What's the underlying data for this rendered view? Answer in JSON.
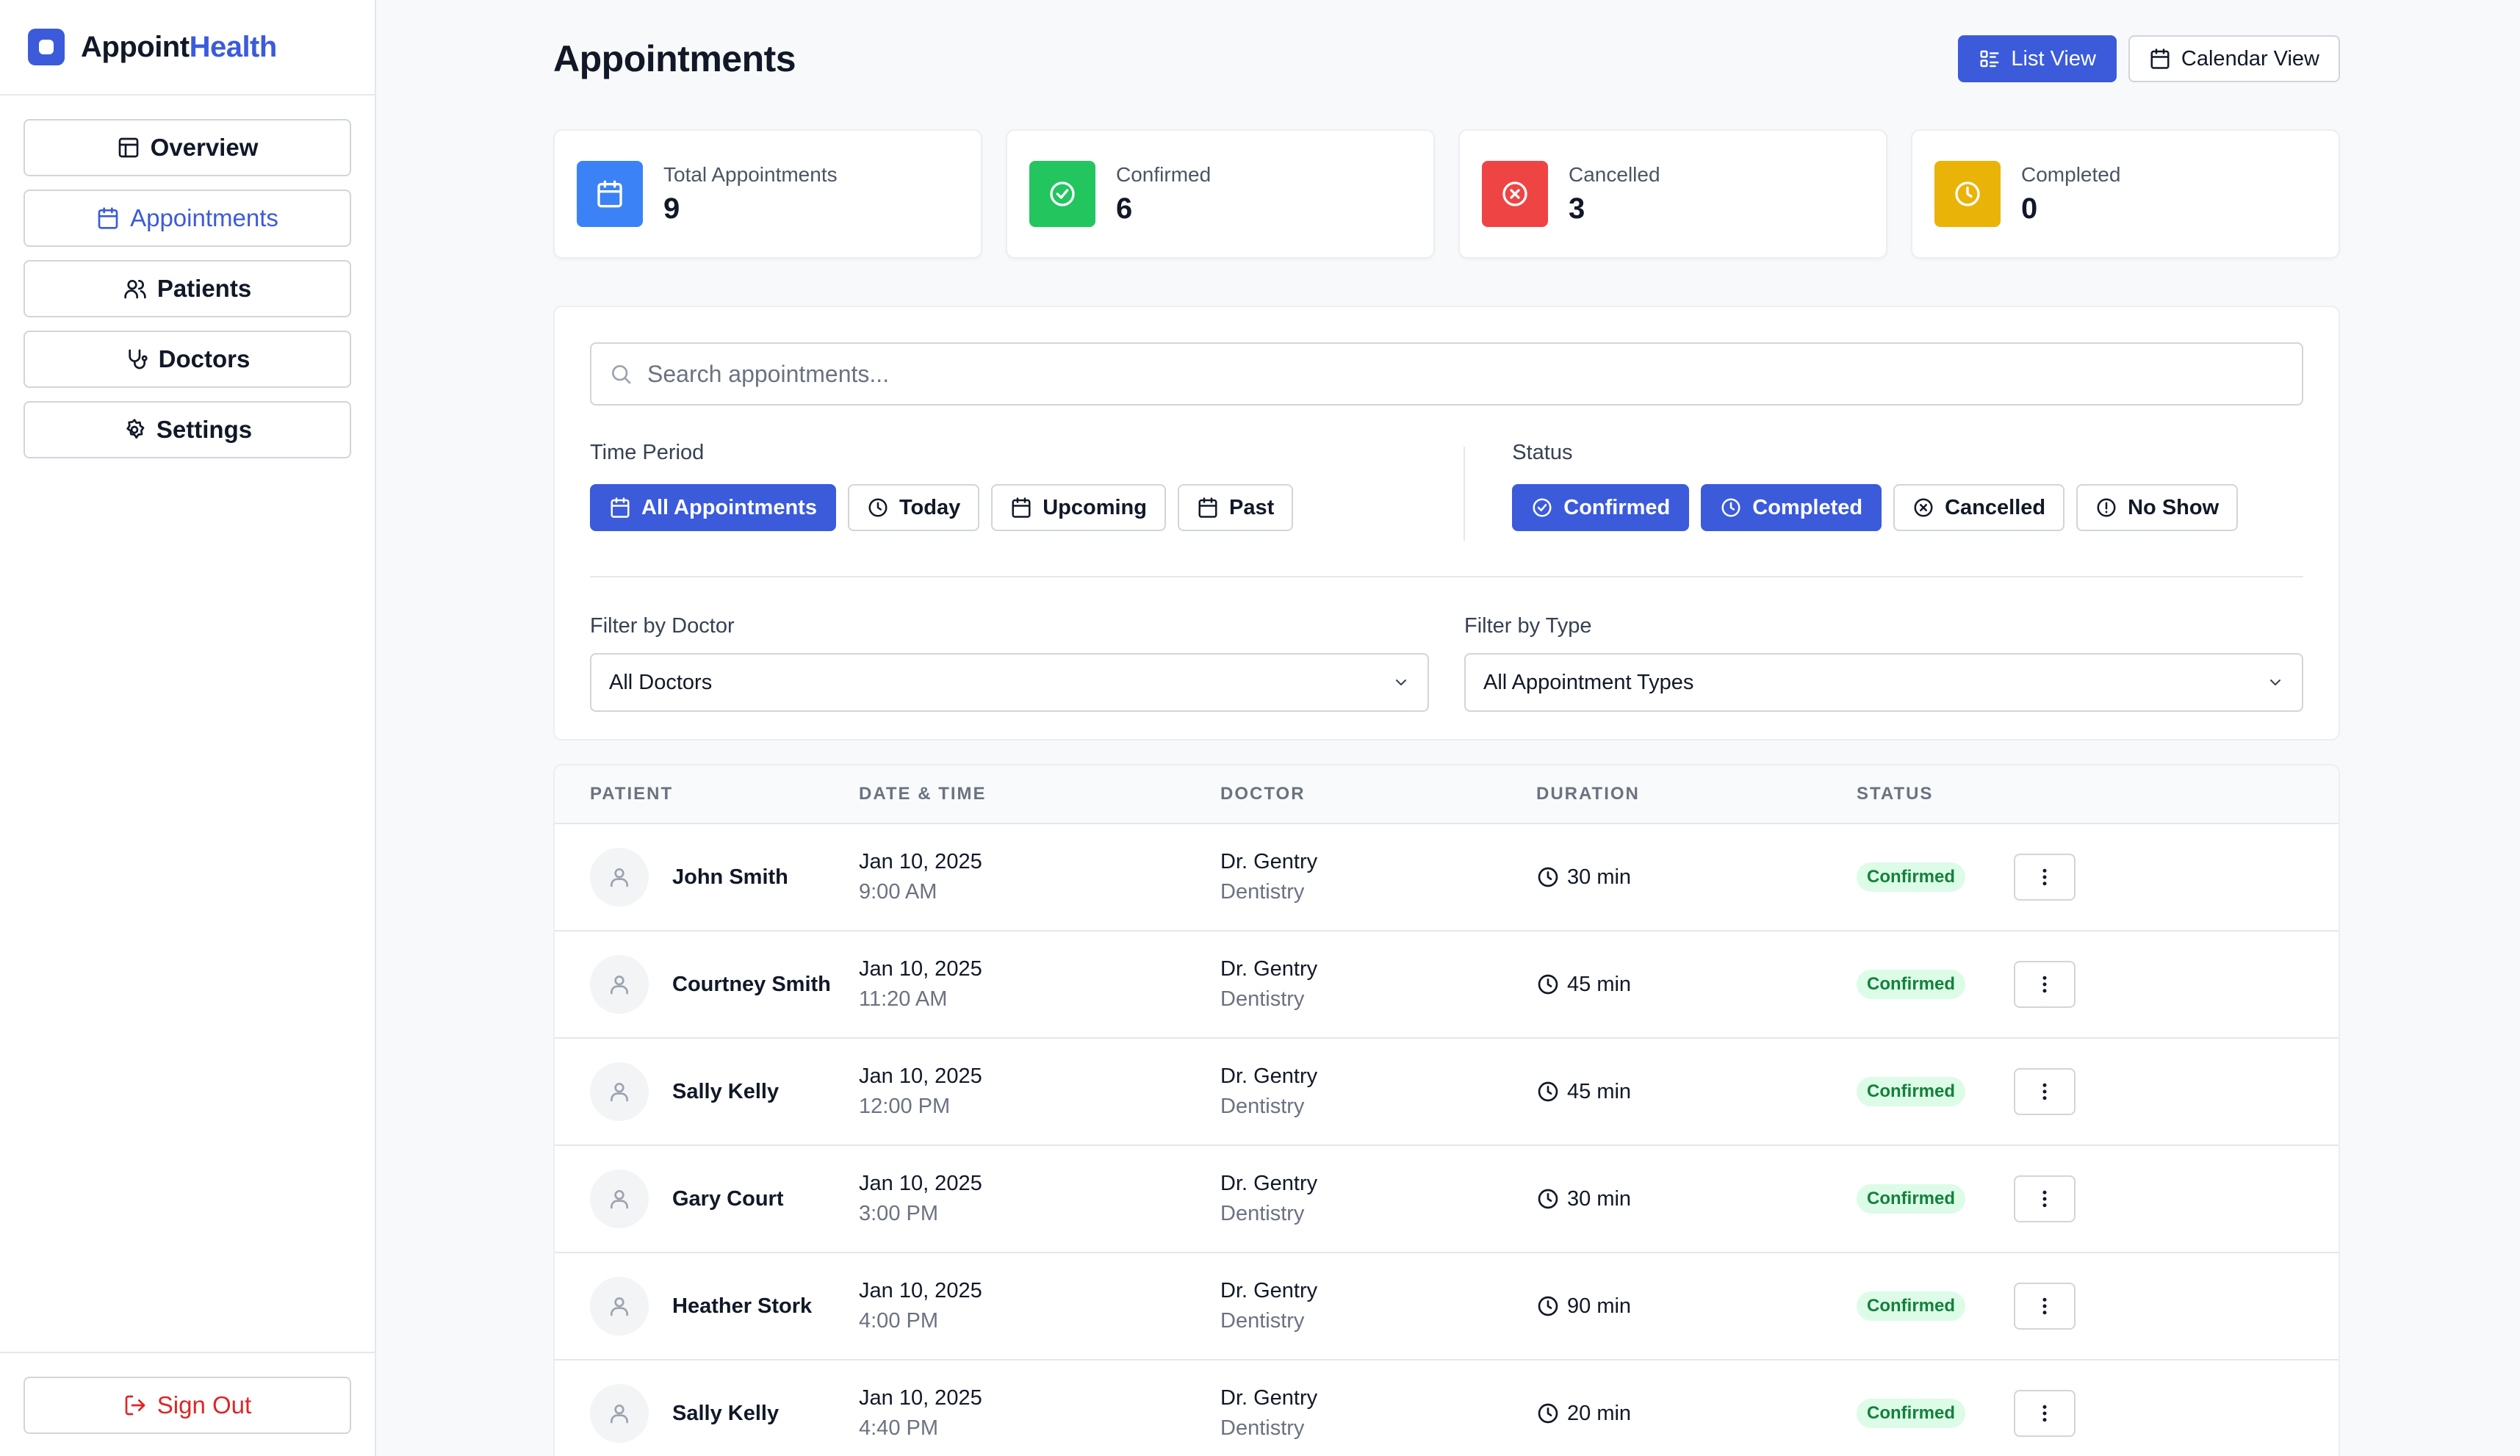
{
  "brand": {
    "name_part1": "Appoint",
    "name_part2": "Health"
  },
  "colors": {
    "accent": "#3b5bdb",
    "blue": "#3b82f6",
    "green": "#22c55e",
    "red": "#ef4444",
    "amber": "#eab308",
    "danger_text": "#dc2626"
  },
  "sidebar": {
    "items": [
      {
        "label": "Overview",
        "icon": "layout-icon"
      },
      {
        "label": "Appointments",
        "icon": "calendar-icon"
      },
      {
        "label": "Patients",
        "icon": "users-icon"
      },
      {
        "label": "Doctors",
        "icon": "stethoscope-icon"
      },
      {
        "label": "Settings",
        "icon": "gear-icon"
      }
    ],
    "signout_label": "Sign Out"
  },
  "header": {
    "title": "Appointments",
    "list_view_label": "List View",
    "calendar_view_label": "Calendar View"
  },
  "stats": [
    {
      "label": "Total Appointments",
      "value": "9",
      "icon": "calendar-icon"
    },
    {
      "label": "Confirmed",
      "value": "6",
      "icon": "check-circle-icon"
    },
    {
      "label": "Cancelled",
      "value": "3",
      "icon": "x-circle-icon"
    },
    {
      "label": "Completed",
      "value": "0",
      "icon": "clock-icon"
    }
  ],
  "filters": {
    "search_placeholder": "Search appointments...",
    "time_period_label": "Time Period",
    "time_period_options": [
      "All Appointments",
      "Today",
      "Upcoming",
      "Past"
    ],
    "status_label": "Status",
    "status_options": [
      "Confirmed",
      "Completed",
      "Cancelled",
      "No Show"
    ],
    "doctor_label": "Filter by Doctor",
    "doctor_value": "All Doctors",
    "type_label": "Filter by Type",
    "type_value": "All Appointment Types"
  },
  "table": {
    "headers": [
      "PATIENT",
      "DATE & TIME",
      "DOCTOR",
      "DURATION",
      "STATUS"
    ],
    "rows": [
      {
        "patient": "John Smith",
        "date": "Jan 10, 2025",
        "time": "9:00 AM",
        "doctor": "Dr. Gentry",
        "specialty": "Dentistry",
        "duration": "30 min",
        "status": "Confirmed"
      },
      {
        "patient": "Courtney Smith",
        "date": "Jan 10, 2025",
        "time": "11:20 AM",
        "doctor": "Dr. Gentry",
        "specialty": "Dentistry",
        "duration": "45 min",
        "status": "Confirmed"
      },
      {
        "patient": "Sally Kelly",
        "date": "Jan 10, 2025",
        "time": "12:00 PM",
        "doctor": "Dr. Gentry",
        "specialty": "Dentistry",
        "duration": "45 min",
        "status": "Confirmed"
      },
      {
        "patient": "Gary Court",
        "date": "Jan 10, 2025",
        "time": "3:00 PM",
        "doctor": "Dr. Gentry",
        "specialty": "Dentistry",
        "duration": "30 min",
        "status": "Confirmed"
      },
      {
        "patient": "Heather Stork",
        "date": "Jan 10, 2025",
        "time": "4:00 PM",
        "doctor": "Dr. Gentry",
        "specialty": "Dentistry",
        "duration": "90 min",
        "status": "Confirmed"
      },
      {
        "patient": "Sally Kelly",
        "date": "Jan 10, 2025",
        "time": "4:40 PM",
        "doctor": "Dr. Gentry",
        "specialty": "Dentistry",
        "duration": "20 min",
        "status": "Confirmed"
      }
    ]
  }
}
